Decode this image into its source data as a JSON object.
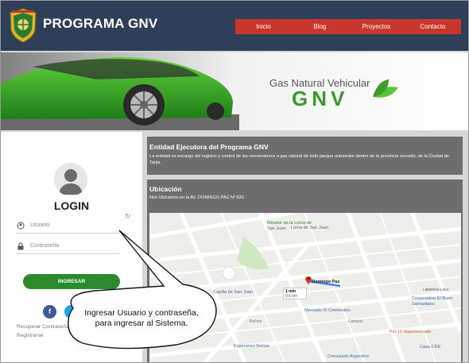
{
  "header": {
    "brand": "PROGRAMA GNV",
    "nav": [
      "Inicio",
      "Blog",
      "Proyectos",
      "Contacto"
    ]
  },
  "banner": {
    "line1": "Gas Natural Vehicular",
    "line2": "GNV"
  },
  "login": {
    "title": "LOGIN",
    "user_placeholder": "Usuario.",
    "password_placeholder": "Contraseña",
    "submit_label": "INGRESAR",
    "facebook_letter": "f",
    "recover_label": "Recuperar Contraseña",
    "register_label": "Registrarse"
  },
  "entity": {
    "title": "Entidad Ejecutora del Programa GNV",
    "text": "La entidad es encargo del registro y control de las conversiones a gas natural de todo parque automotor dentro de la provincia cercado, de la Ciudad de Tarija."
  },
  "location": {
    "title": "Ubicación",
    "text": "Nos Ubicamos en la AV. DOMINGO PAZ Nº 832"
  },
  "map": {
    "labels": {
      "mirador": "Mirador de la Loma de San Juan",
      "loma": "Loma de San Juan",
      "capilla": "Capilla de San Juan",
      "domingo_paz": "Domingo Paz",
      "mercado": "Mercado IV Centenario",
      "cooperativa": "Cooperativa El Buen Samaritano",
      "esperanza": "Esperanza Bolivia",
      "consulado": "Consulado Argentino",
      "casa": "Casa CRE",
      "libreria": "LIBRERIA LIGA",
      "bolivar": "Bolívar",
      "campos": "Campos",
      "hipermercado": "Kid 10 Hipermercado"
    },
    "route_time": "1 min",
    "route_dist": "0.6 km"
  },
  "callout": {
    "line1": "Ingresar Usuario y contraseña,",
    "line2": "para ingresar al Sistema."
  },
  "colors": {
    "header": "#2f3f57",
    "nav": "#c9372c",
    "panel": "#6e6e6e",
    "button": "#2b8a2b"
  }
}
